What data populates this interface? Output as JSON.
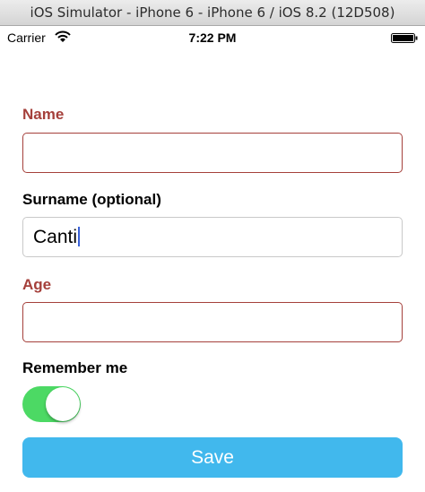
{
  "window": {
    "title": "iOS Simulator - iPhone 6 - iPhone 6 / iOS 8.2 (12D508)"
  },
  "status_bar": {
    "carrier": "Carrier",
    "time": "7:22 PM",
    "icons": [
      "wifi-icon",
      "battery-icon"
    ]
  },
  "form": {
    "name": {
      "label": "Name",
      "value": "",
      "state": "error"
    },
    "surname": {
      "label": "Surname (optional)",
      "value": "Canti",
      "state": "focused"
    },
    "age": {
      "label": "Age",
      "value": "",
      "state": "error"
    },
    "remember": {
      "label": "Remember me",
      "on": true
    },
    "save_label": "Save"
  },
  "colors": {
    "error": "#a5403b",
    "toggle_on": "#4cd964",
    "button": "#41b8ed",
    "caret": "#3a62d8"
  }
}
